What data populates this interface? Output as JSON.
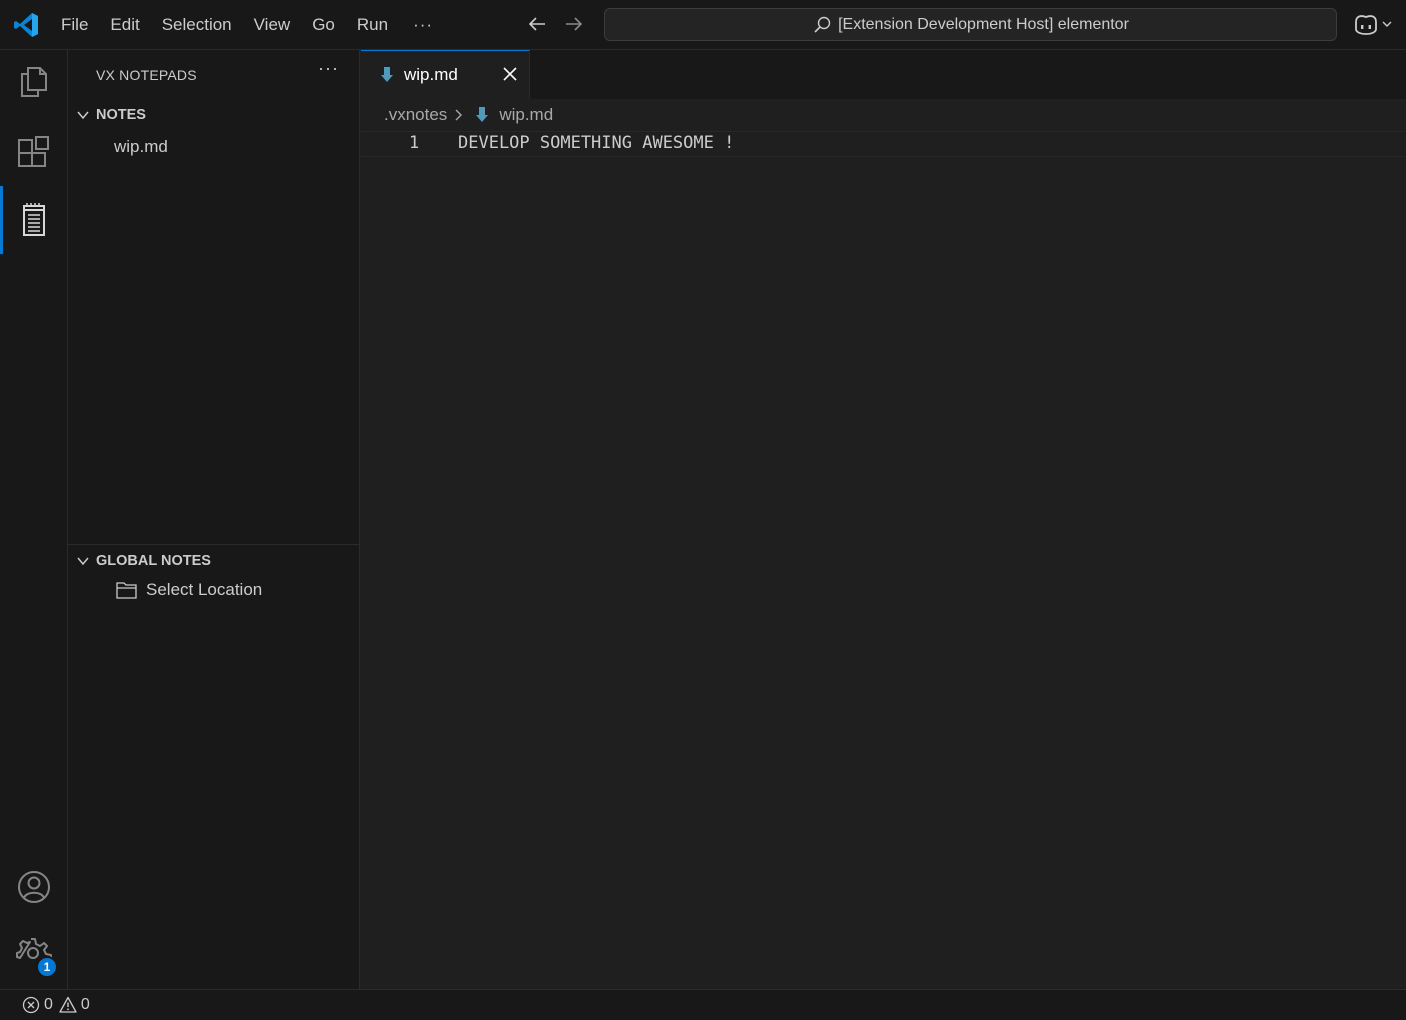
{
  "titlebar": {
    "menu": [
      "File",
      "Edit",
      "Selection",
      "View",
      "Go",
      "Run"
    ],
    "more": "···",
    "command_center": "[Extension Development Host] elementor"
  },
  "activity_bar": {
    "items": [
      "explorer-icon",
      "extensions-icon",
      "notepad-icon"
    ],
    "bottom": [
      "account-icon",
      "settings-gear-icon"
    ],
    "settings_badge": "1",
    "accent": "#0078d4"
  },
  "sidebar": {
    "title": "VX NOTEPADS",
    "more": "···",
    "sections": [
      {
        "label": "NOTES",
        "items": [
          "wip.md"
        ]
      },
      {
        "label": "GLOBAL NOTES",
        "items": [
          "Select Location"
        ]
      }
    ]
  },
  "editor": {
    "tab": {
      "label": "wip.md"
    },
    "breadcrumb": [
      ".vxnotes",
      "wip.md"
    ],
    "lines": [
      {
        "number": "1",
        "text": "DEVELOP SOMETHING AWESOME !"
      }
    ]
  },
  "statusbar": {
    "errors": "0",
    "warnings": "0"
  }
}
